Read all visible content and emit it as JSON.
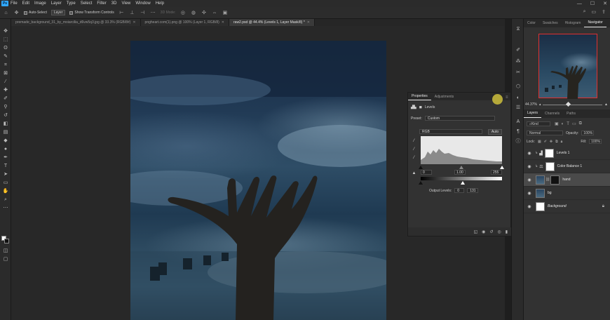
{
  "menu": {
    "logo": "Ps",
    "items": [
      "File",
      "Edit",
      "Image",
      "Layer",
      "Type",
      "Select",
      "Filter",
      "3D",
      "View",
      "Window",
      "Help"
    ]
  },
  "window_controls": [
    "—",
    "☐",
    "✕"
  ],
  "options": {
    "auto_select_label": "Auto-Select",
    "auto_select_target": "Layer",
    "transform_controls_label": "Show Transform Controls",
    "mode_3d_label": "3D Mode:"
  },
  "tabs": [
    {
      "label": "premade_background_31_by_moiarcilia_d6vw5q3.jpg @ 33.3% (RGB/8#)",
      "active": false
    },
    {
      "label": "pngheart.com(1).png @ 100% (Layer 1, RGB/8)",
      "active": false
    },
    {
      "label": "raw2.psd @ 44.4% (Levels 1, Layer Mask/8) *",
      "active": true
    }
  ],
  "properties": {
    "tabs": [
      "Properties",
      "Adjustments"
    ],
    "active_tab": "Properties",
    "adjustment_name": "Levels",
    "preset_label": "Preset:",
    "preset_value": "Custom",
    "channel_value": "RGB",
    "auto_label": "Auto",
    "input_black": "0",
    "input_mid": "1.00",
    "input_white": "255",
    "output_label": "Output Levels:",
    "output_black": "0",
    "output_white": "131"
  },
  "right_panel": {
    "top_tabs": [
      "Color",
      "Swatches",
      "Histogram",
      "Navigator"
    ],
    "active_top_tab": "Navigator",
    "zoom": "44.37%",
    "layer_tabs": [
      "Layers",
      "Channels",
      "Paths"
    ],
    "active_layer_tab": "Layers",
    "kind_label": "Kind",
    "blend_mode": "Normal",
    "opacity_label": "Opacity:",
    "opacity_value": "100%",
    "lock_label": "Lock:",
    "fill_label": "Fill:",
    "fill_value": "100%"
  },
  "layers": [
    {
      "name": "Levels 1",
      "selected": false
    },
    {
      "name": "Color Balance 1",
      "selected": false
    },
    {
      "name": "hand",
      "selected": true
    },
    {
      "name": "bg",
      "selected": false
    },
    {
      "name": "Background",
      "selected": false
    }
  ]
}
